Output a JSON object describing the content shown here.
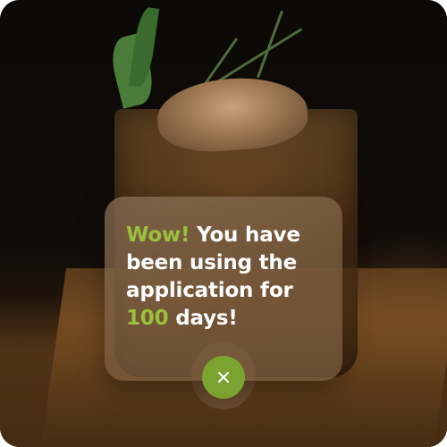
{
  "popup": {
    "message_highlight_start": "Wow!",
    "message_middle": " You have been using the application for ",
    "message_highlight_count": "100",
    "message_end": " days!"
  },
  "colors": {
    "accent": "#9bc13c",
    "close_button": "#7aa42f",
    "text": "#ffffff"
  },
  "icons": {
    "close": "close-icon"
  }
}
